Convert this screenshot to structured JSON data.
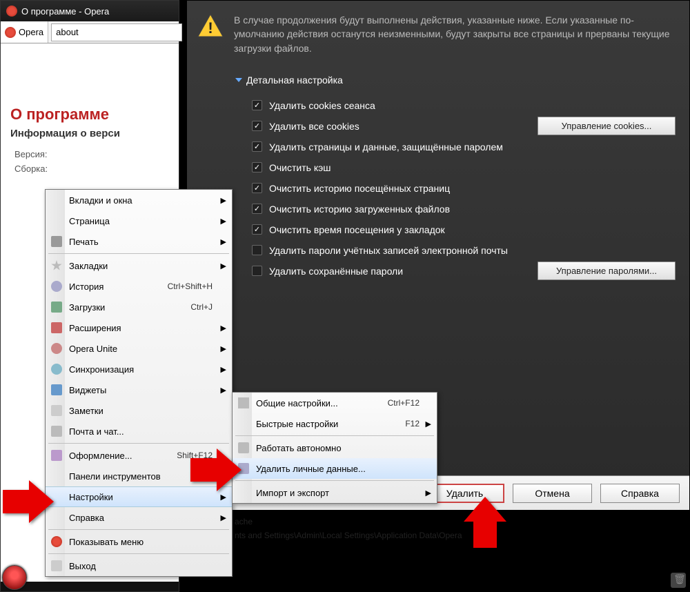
{
  "window": {
    "title": "О программе - Opera",
    "opera_btn": "Opera",
    "address": "about"
  },
  "about_page": {
    "title": "О программе",
    "subtitle": "Информация о верси",
    "version_label": "Версия:",
    "build_label": "Сборка:"
  },
  "dialog": {
    "warning_text": "В случае продолжения будут выполнены действия, указанные ниже. Если указанные по-умолчанию действия останутся неизменными, будут закрыты все страницы и прерваны текущие загрузки файлов.",
    "details_label": "Детальная настройка",
    "checks": [
      {
        "label": "Удалить cookies сеанса",
        "checked": true
      },
      {
        "label": "Удалить все cookies",
        "checked": true
      },
      {
        "label": "Удалить страницы и данные, защищённые паролем",
        "checked": true
      },
      {
        "label": "Очистить кэш",
        "checked": true
      },
      {
        "label": "Очистить историю посещённых страниц",
        "checked": true
      },
      {
        "label": "Очистить историю загруженных файлов",
        "checked": true
      },
      {
        "label": "Очистить время посещения у закладок",
        "checked": true
      },
      {
        "label": "Удалить пароли учётных записей электронной почты",
        "checked": false
      },
      {
        "label": "Удалить сохранённые пароли",
        "checked": false
      }
    ],
    "cookies_btn": "Управление cookies...",
    "passwords_btn": "Управление паролями...",
    "delete_btn": "Удалить",
    "cancel_btn": "Отмена",
    "help_btn": "Справка"
  },
  "menu": {
    "items": [
      {
        "label": "Вкладки и окна",
        "submenu": true
      },
      {
        "label": "Страница",
        "submenu": true
      },
      {
        "label": "Печать",
        "submenu": true,
        "icon": "print"
      },
      {
        "sep": true
      },
      {
        "label": "Закладки",
        "submenu": true,
        "icon": "star"
      },
      {
        "label": "История",
        "shortcut": "Ctrl+Shift+H",
        "icon": "clock"
      },
      {
        "label": "Загрузки",
        "shortcut": "Ctrl+J",
        "icon": "dl"
      },
      {
        "label": "Расширения",
        "submenu": true,
        "icon": "puzzle"
      },
      {
        "label": "Opera Unite",
        "submenu": true,
        "icon": "unite"
      },
      {
        "label": "Синхронизация",
        "submenu": true,
        "icon": "sync"
      },
      {
        "label": "Виджеты",
        "submenu": true,
        "icon": "widget"
      },
      {
        "label": "Заметки",
        "icon": "note"
      },
      {
        "label": "Почта и чат...",
        "icon": "mail"
      },
      {
        "sep": true
      },
      {
        "label": "Оформление...",
        "shortcut": "Shift+F12",
        "icon": "paint"
      },
      {
        "label": "Панели инструментов",
        "submenu": true
      },
      {
        "label": "Настройки",
        "submenu": true,
        "hi": true
      },
      {
        "label": "Справка",
        "submenu": true
      },
      {
        "sep": true
      },
      {
        "label": "Показывать меню",
        "icon": "opera"
      },
      {
        "sep": true
      },
      {
        "label": "Выход",
        "icon": "exit"
      }
    ]
  },
  "submenu": {
    "items": [
      {
        "label": "Общие настройки...",
        "shortcut": "Ctrl+F12",
        "icon": "wrench"
      },
      {
        "label": "Быстрые настройки",
        "shortcut": "F12",
        "submenu": true
      },
      {
        "sep": true
      },
      {
        "label": "Работать автономно",
        "icon": "generic"
      },
      {
        "label": "Удалить личные данные...",
        "icon": "del",
        "hi": true
      },
      {
        "sep": true
      },
      {
        "label": "Импорт и экспорт",
        "submenu": true
      }
    ]
  },
  "paths": {
    "line1": "ache",
    "line2": "nts and Settings\\Admin\\Local Settings\\Application Data\\Opera"
  }
}
